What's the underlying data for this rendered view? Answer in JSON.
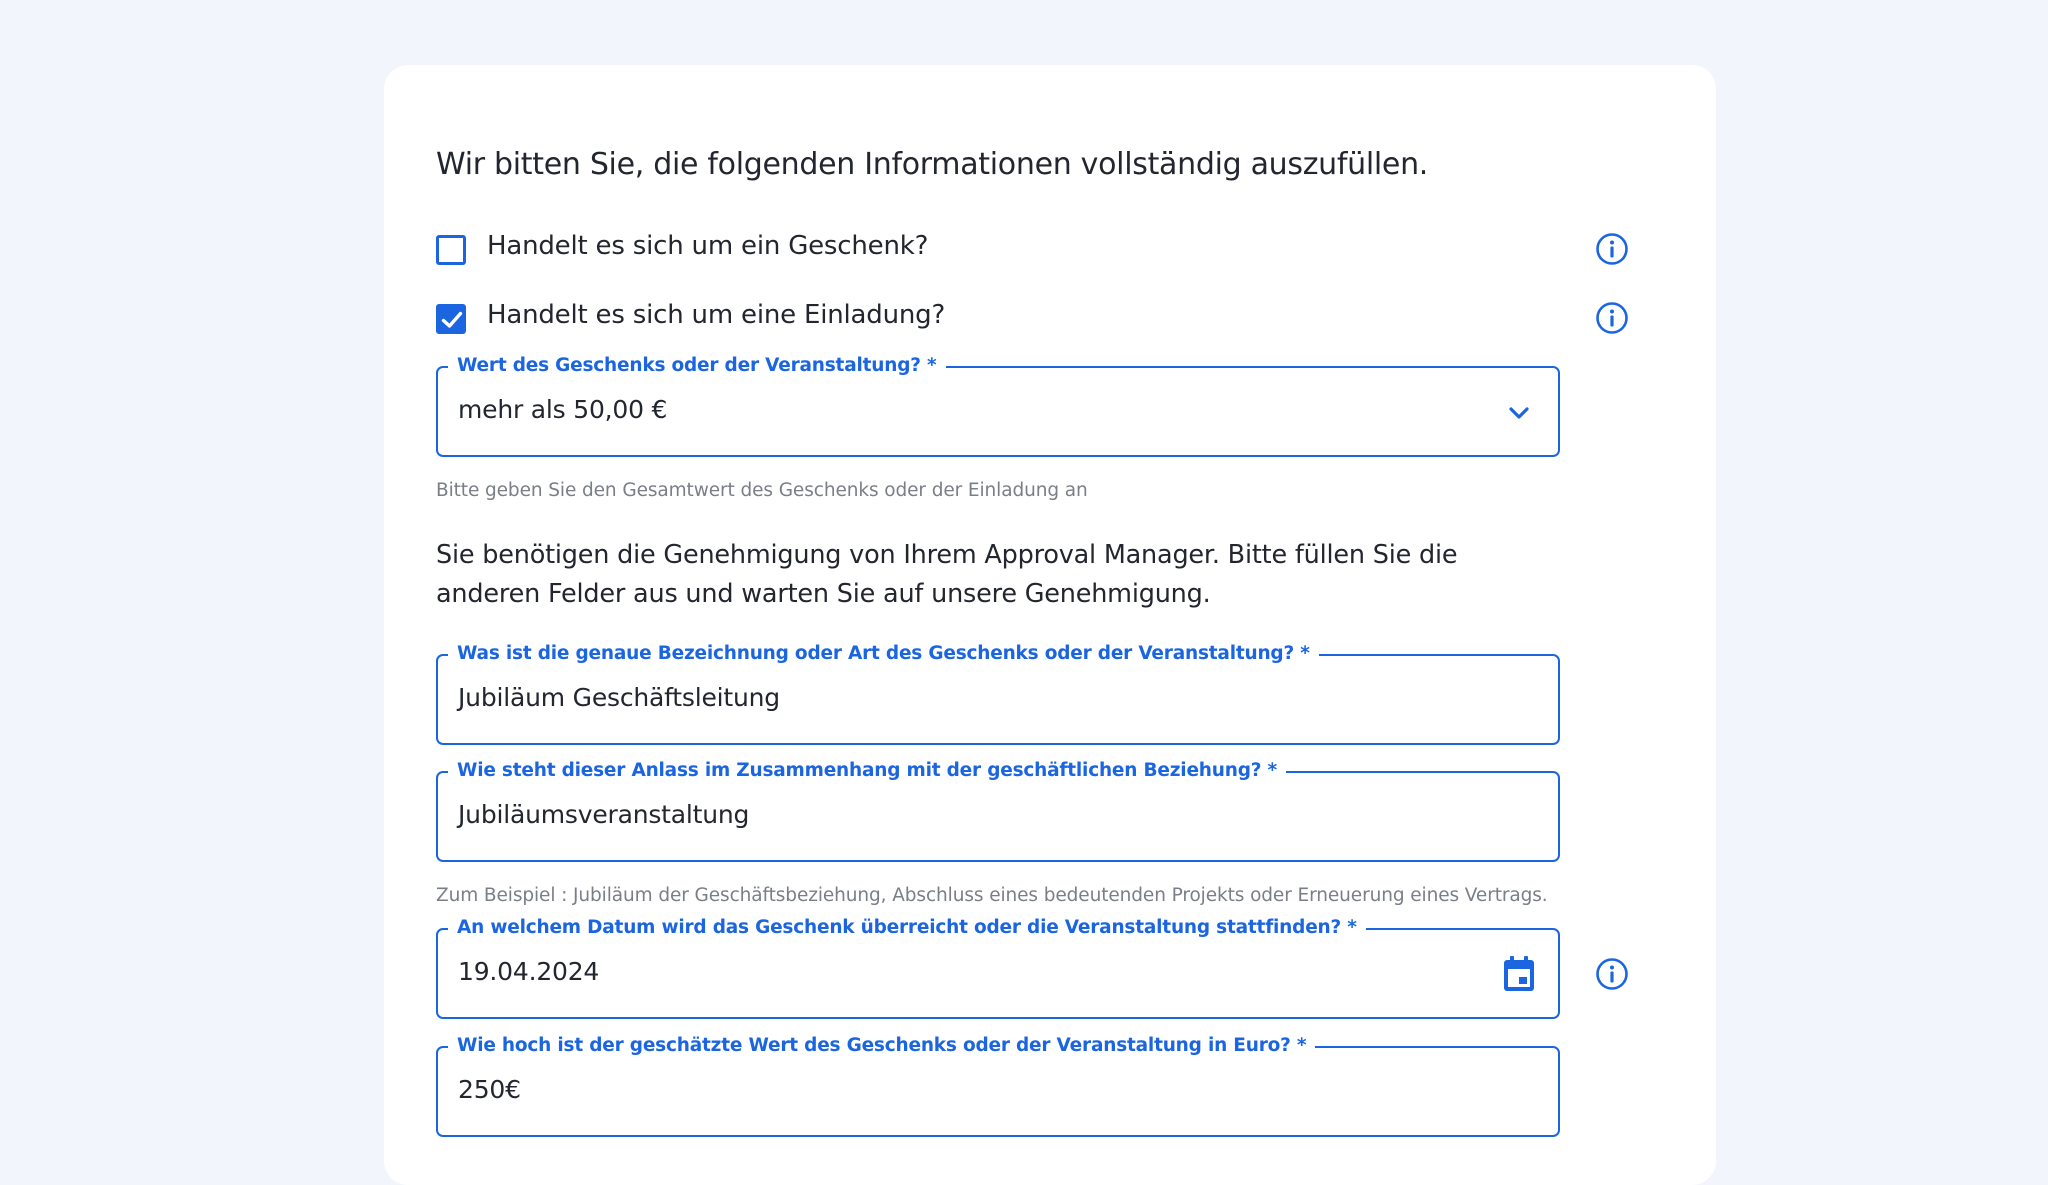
{
  "form": {
    "intro": "Wir bitten Sie, die folgenden Informationen vollständig auszufüllen.",
    "checkboxes": [
      {
        "label": "Handelt es sich um ein Geschenk?",
        "checked": false
      },
      {
        "label": "Handelt es sich um eine Einladung?",
        "checked": true
      }
    ],
    "value_select": {
      "label": "Wert des Geschenks oder der Veranstaltung? *",
      "selected": "mehr als 50,00 €",
      "hint": "Bitte geben Sie den Gesamtwert des Geschenks oder der Einladung an"
    },
    "approval_notice": "Sie benötigen die Genehmigung von Ihrem Approval Manager. Bitte füllen Sie die anderen Felder aus und warten Sie auf unsere Genehmigung.",
    "designation": {
      "label": "Was ist die genaue Bezeichnung oder Art des Geschenks oder der Veranstaltung? *",
      "value": "Jubiläum Geschäftsleitung"
    },
    "relation": {
      "label": "Wie steht dieser Anlass im Zusammenhang mit der geschäftlichen Beziehung? *",
      "value": "Jubiläumsveranstaltung",
      "hint": "Zum Beispiel : Jubiläum der Geschäftsbeziehung, Abschluss eines bedeutenden Projekts oder Erneuerung eines Vertrags."
    },
    "date": {
      "label": "An welchem Datum wird das Geschenk überreicht oder die Veranstaltung stattfinden? *",
      "value": "19.04.2024"
    },
    "estimated_value": {
      "label": "Wie hoch ist der geschätzte Wert des Geschenks oder der Veranstaltung in Euro? *",
      "value": "250€"
    }
  },
  "icons": {
    "info": "info-icon",
    "dropdown": "chevron-down-icon",
    "calendar": "calendar-icon",
    "check": "check-icon"
  },
  "colors": {
    "accent": "#1b66e0",
    "background": "#f3f5fc",
    "card": "#ffffff",
    "hint_text": "#7a7e87"
  }
}
